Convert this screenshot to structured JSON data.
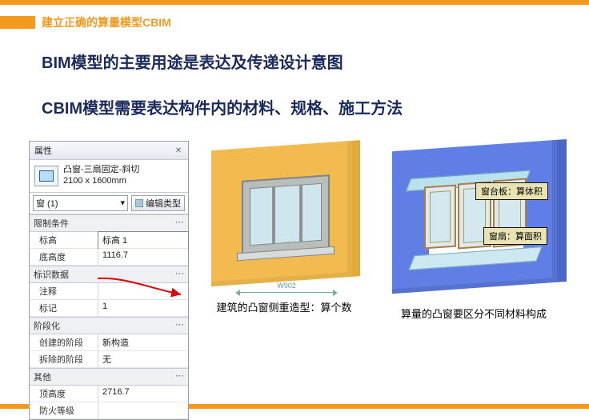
{
  "header": {
    "title": "建立正确的算量模型CBIM"
  },
  "headings": {
    "h1": "BIM模型的主要用途是表达及传递设计意图",
    "h2": "CBIM模型需要表达构件内的材料、规格、施工方法"
  },
  "properties_panel": {
    "title": "属性",
    "family_type_name": "凸窗-三扇固定-斜切",
    "family_size": "2100 x 1600mm",
    "instance_selector": "窗 (1)",
    "edit_type_label": "编辑类型",
    "groups": {
      "constraints": {
        "label": "限制条件",
        "rows": {
          "level": {
            "label": "标高",
            "value": "标高 1"
          },
          "sill_height": {
            "label": "底高度",
            "value": "1116.7"
          }
        }
      },
      "identity": {
        "label": "标识数据",
        "rows": {
          "comment": {
            "label": "注释",
            "value": ""
          },
          "mark": {
            "label": "标记",
            "value": "1"
          }
        }
      },
      "phasing": {
        "label": "阶段化",
        "rows": {
          "created": {
            "label": "创建的阶段",
            "value": "新构造"
          },
          "demolished": {
            "label": "拆除的阶段",
            "value": "无"
          }
        }
      },
      "other": {
        "label": "其他",
        "rows": {
          "top_height": {
            "label": "顶高度",
            "value": "2716.7"
          },
          "fire_rate": {
            "label": "防火等级",
            "value": ""
          }
        }
      }
    }
  },
  "figures": {
    "left": {
      "dim_label": "W902",
      "caption": "建筑的凸窗侧重造型：算个数"
    },
    "right": {
      "label_board": "窗台板：算体积",
      "label_sash": "窗扇：算面积",
      "caption": "算量的凸窗要区分不同材料构成"
    }
  }
}
